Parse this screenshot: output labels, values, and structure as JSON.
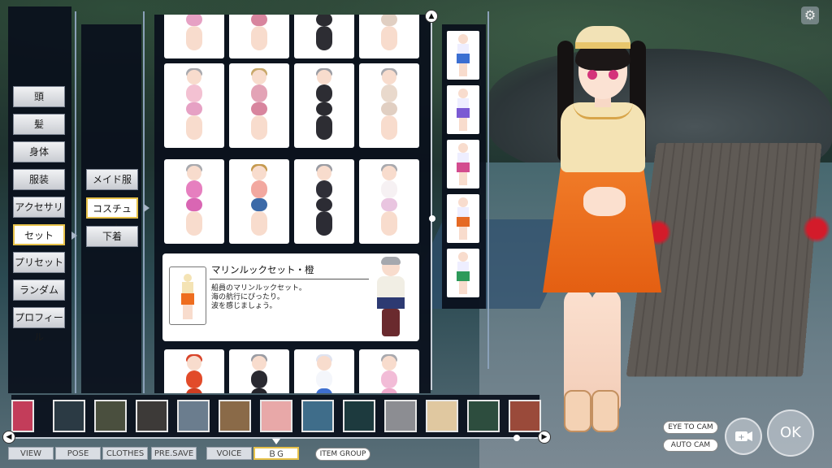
{
  "left_menu": [
    {
      "label": "頭",
      "selected": false
    },
    {
      "label": "髪",
      "selected": false
    },
    {
      "label": "身体",
      "selected": false
    },
    {
      "label": "服装",
      "selected": false
    },
    {
      "label": "アクセサリ",
      "selected": false
    },
    {
      "label": "セット",
      "selected": true
    },
    {
      "label": "プリセット",
      "selected": false
    },
    {
      "label": "ランダム",
      "selected": false
    },
    {
      "label": "プロフィール",
      "selected": false
    }
  ],
  "sub_menu": [
    {
      "label": "メイド服",
      "selected": false
    },
    {
      "label": "コスチューム",
      "selected": true
    },
    {
      "label": "下着",
      "selected": false
    }
  ],
  "item_detail": {
    "title": "マリンルックセット・橙",
    "desc1": "船員のマリンルックセット。",
    "desc2": "海の航行にぴったり。",
    "desc3": "波を感じましょう。"
  },
  "grid_cards": [
    {
      "hair": "#a8a9ae",
      "top": "#f3c1d2",
      "bottom": "#e6a1c4",
      "legs": "#f8dccd"
    },
    {
      "hair": "#c8a86a",
      "top": "#e3a3b6",
      "bottom": "#d8859e",
      "legs": "#f8dccd"
    },
    {
      "hair": "#9a9ca3",
      "top": "#2d2d33",
      "bottom": "#2b2b31",
      "legs": "#2d2d33"
    },
    {
      "hair": "#a8a9ae",
      "top": "#e9d9cc",
      "bottom": "#e1cfc2",
      "legs": "#f8dccd"
    },
    {
      "hair": "#a8a9ae",
      "top": "#e67fbf",
      "bottom": "#d966b3",
      "legs": "#f8dccd"
    },
    {
      "hair": "#c59a4f",
      "top": "#f2a8a0",
      "bottom": "#3c6aa8",
      "legs": "#f8dccd"
    },
    {
      "hair": "#9a9ca3",
      "top": "#2f2f38",
      "bottom": "#2c2c34",
      "legs": "#2c2c34"
    },
    {
      "hair": "#a8a9ae",
      "top": "#f6f1f3",
      "bottom": "#e9c5e0",
      "legs": "#f8dccd"
    },
    {
      "hair": "#d8442a",
      "top": "#e24b2a",
      "bottom": "#cf3e21",
      "legs": "#f8dccd"
    },
    {
      "hair": "#9a9ca3",
      "top": "#2a2a31",
      "bottom": "#25252b",
      "legs": "#25252b"
    },
    {
      "hair": "#dfe3f0",
      "top": "#f4f6fb",
      "bottom": "#3e6fcf",
      "legs": "#f8dccd"
    },
    {
      "hair": "#a8a9ae",
      "top": "#f2bcd7",
      "bottom": "#f0aacc",
      "legs": "#f8dccd"
    }
  ],
  "side_thumbs": [
    {
      "color": "#3b6fd2"
    },
    {
      "color": "#7b5ad3"
    },
    {
      "color": "#d34c8f"
    },
    {
      "color": "#e56a24"
    },
    {
      "color": "#2d9a5a"
    }
  ],
  "bottom_tabs": [
    {
      "label": "VIEW",
      "selected": false
    },
    {
      "label": "POSE",
      "selected": false
    },
    {
      "label": "CLOTHES",
      "selected": false
    },
    {
      "label": "PRE.SAVE",
      "selected": false
    },
    {
      "label": "VOICE",
      "selected": false
    },
    {
      "label": "ＢＧ",
      "selected": true
    }
  ],
  "item_group_label": "ITEM GROUP",
  "cam_buttons": {
    "eye_to_cam": "EYE TO CAM",
    "auto_cam": "AUTO CAM"
  },
  "ok_label": "OK",
  "bg_thumbs": [
    "#c33d5a",
    "#2b3a44",
    "#4a4f3e",
    "#3d3a38",
    "#6b7d8e",
    "#8a6a48",
    "#e8a8a8",
    "#3f6d8a",
    "#1d3a3e",
    "#8c8d92",
    "#e0c8a0",
    "#2d4d3e",
    "#9a4a3a"
  ]
}
